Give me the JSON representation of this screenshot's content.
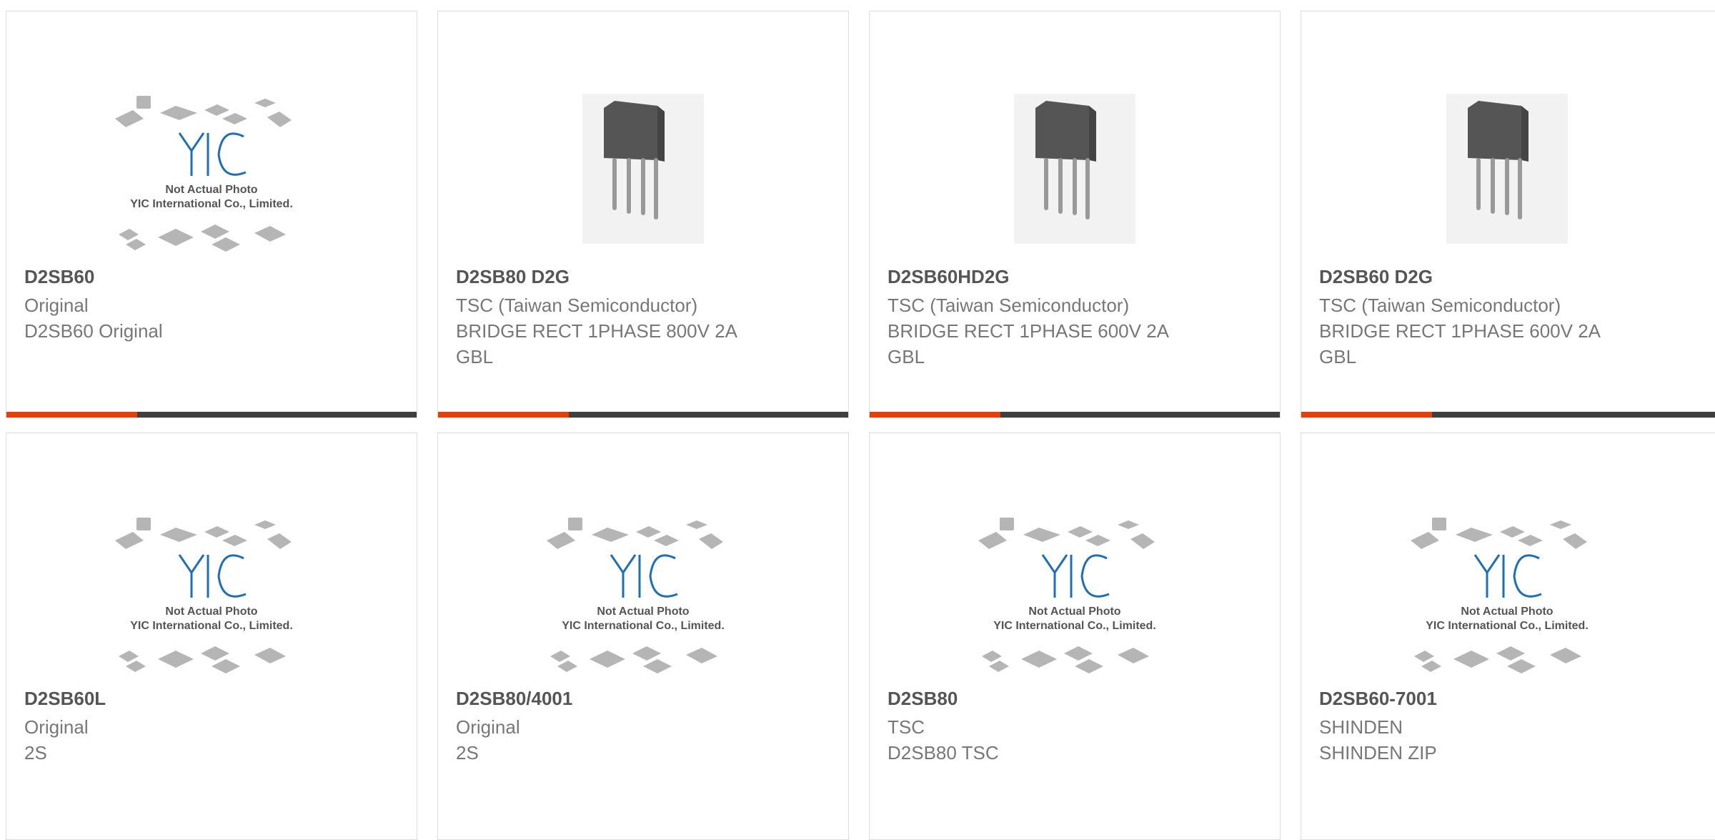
{
  "products": [
    {
      "part": "D2SB60",
      "line1": "Original",
      "line2": "D2SB60 Original",
      "line3": "",
      "image": "placeholder"
    },
    {
      "part": "D2SB80 D2G",
      "line1": "TSC (Taiwan Semiconductor)",
      "line2": "BRIDGE RECT 1PHASE 800V 2A",
      "line3": "GBL",
      "image": "component"
    },
    {
      "part": "D2SB60HD2G",
      "line1": "TSC (Taiwan Semiconductor)",
      "line2": "BRIDGE RECT 1PHASE 600V 2A",
      "line3": "GBL",
      "image": "component"
    },
    {
      "part": "D2SB60 D2G",
      "line1": "TSC (Taiwan Semiconductor)",
      "line2": "BRIDGE RECT 1PHASE 600V 2A",
      "line3": "GBL",
      "image": "component"
    },
    {
      "part": "D2SB60L",
      "line1": "Original",
      "line2": "2S",
      "line3": "",
      "image": "placeholder"
    },
    {
      "part": "D2SB80/4001",
      "line1": "Original",
      "line2": "2S",
      "line3": "",
      "image": "placeholder"
    },
    {
      "part": "D2SB80",
      "line1": "TSC",
      "line2": "D2SB80 TSC",
      "line3": "",
      "image": "placeholder"
    },
    {
      "part": "D2SB60-7001",
      "line1": "SHINDEN",
      "line2": "SHINDEN ZIP",
      "line3": "",
      "image": "placeholder"
    }
  ],
  "placeholder": {
    "logo_text": "YIC",
    "caption1": "Not Actual Photo",
    "caption2": "YIC International Co., Limited."
  },
  "colors": {
    "accent": "#e3400b",
    "bar": "#3f3f3f",
    "logo": "#1f6fb5"
  }
}
